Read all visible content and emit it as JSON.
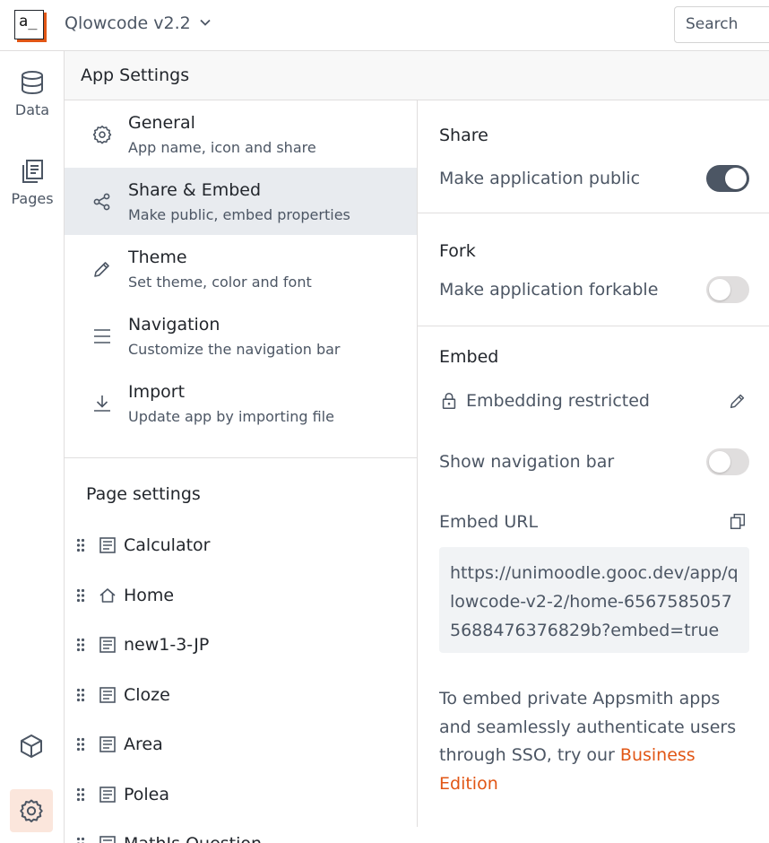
{
  "header": {
    "logo_text": "a_",
    "app_name": "Qlowcode v2.2",
    "search_placeholder": "Search"
  },
  "rail": {
    "items": [
      {
        "label": "Data",
        "icon": "database-icon"
      },
      {
        "label": "Pages",
        "icon": "pages-icon"
      }
    ],
    "bottom_icons": [
      "cube-icon",
      "gear-icon"
    ]
  },
  "settings": {
    "title": "App Settings",
    "menu": [
      {
        "title": "General",
        "subtitle": "App name, icon and share",
        "icon": "gear-icon"
      },
      {
        "title": "Share & Embed",
        "subtitle": "Make public, embed properties",
        "icon": "share-icon",
        "active": true
      },
      {
        "title": "Theme",
        "subtitle": "Set theme, color and font",
        "icon": "pencil-icon"
      },
      {
        "title": "Navigation",
        "subtitle": "Customize the navigation bar",
        "icon": "menu-icon"
      },
      {
        "title": "Import",
        "subtitle": "Update app by importing file",
        "icon": "download-icon"
      }
    ],
    "page_settings_title": "Page settings",
    "pages": [
      {
        "name": "Calculator",
        "icon": "page-icon"
      },
      {
        "name": "Home",
        "icon": "home-icon"
      },
      {
        "name": "new1-3-JP",
        "icon": "page-icon"
      },
      {
        "name": "Cloze",
        "icon": "page-icon"
      },
      {
        "name": "Area",
        "icon": "page-icon"
      },
      {
        "name": "Polea",
        "icon": "page-icon"
      },
      {
        "name": "MathJs Question",
        "icon": "page-icon"
      }
    ]
  },
  "share_embed": {
    "share_title": "Share",
    "make_public_label": "Make application public",
    "make_public": true,
    "fork_title": "Fork",
    "forkable_label": "Make application forkable",
    "forkable": false,
    "embed_title": "Embed",
    "embedding_status": "Embedding restricted",
    "show_nav_label": "Show navigation bar",
    "show_nav": false,
    "embed_url_label": "Embed URL",
    "embed_url": "https://unimoodle.gooc.dev/app/qlowcode-v2-2/home-65675850575688476376829b?embed=true",
    "promo_text": "To embed private Appsmith apps and seamlessly authenticate users through SSO, try our ",
    "promo_link": "Business Edition"
  },
  "colors": {
    "accent": "#e15615",
    "toggle_on": "#4c5664",
    "toggle_off": "#e0dede",
    "active_menu": "#e8ebef"
  }
}
